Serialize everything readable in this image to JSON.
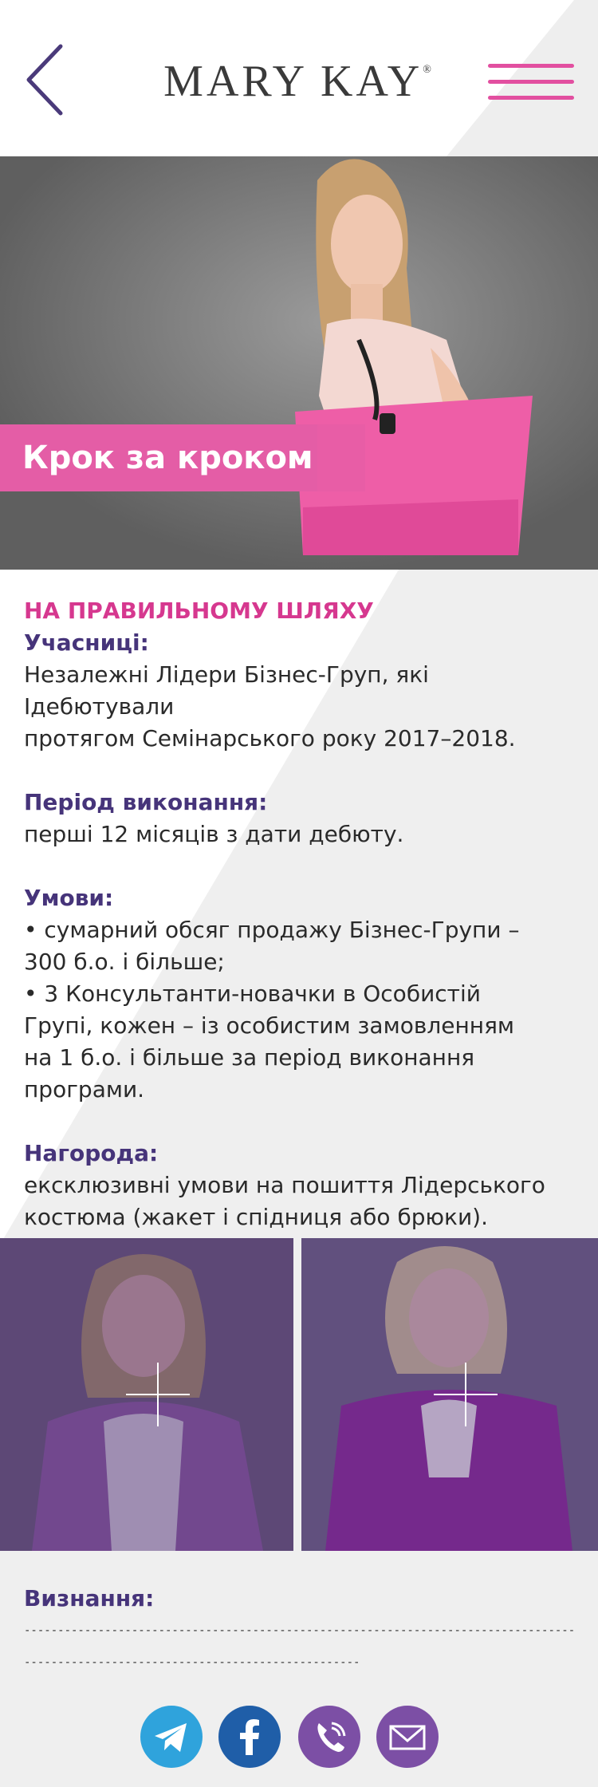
{
  "header": {
    "logo_text": "MARY KAY",
    "logo_mark": "®",
    "back_icon": "chevron-left-icon",
    "menu_icon": "hamburger-menu-icon",
    "accent_color": "#e24fa0"
  },
  "hero": {
    "title": "Крок за кроком"
  },
  "content": {
    "heading": "НА ПРАВИЛЬНОМУ ШЛЯХУ",
    "participants_label": "Учасниці:",
    "participants_lines": [
      "Незалежні Лідери Бізнес-Груп, які Ідебютували",
      "протягом Семінарського року 2017–2018."
    ],
    "period_label": "Період виконання:",
    "period_value": "перші 12 місяців з дати дебюту.",
    "conditions_label": "Умови:",
    "conditions_lines": [
      "• сумарний обсяг продажу Бізнес-Групи –",
      "300 б.о. і більше;",
      "• 3 Консультанти-новачки в Особистій",
      "Групі, кожен – із особистим замовленням",
      "на 1 б.о. і більше за період виконання",
      "програми."
    ],
    "reward_label": "Нагорода:",
    "reward_lines": [
      "ексклюзивні умови на пошиття Лідерського",
      "костюма (жакет і спідниця або брюки)."
    ]
  },
  "photos": {
    "left_icon": "plus-icon",
    "right_icon": "plus-icon"
  },
  "recognition": {
    "label": "Визнання:",
    "line1": "----------------------------------------------------------------------------------",
    "line2": "--------------------------------------------------"
  },
  "socials": [
    {
      "name": "telegram-icon",
      "color": "#2fa3dc"
    },
    {
      "name": "facebook-icon",
      "color": "#1f5ea8"
    },
    {
      "name": "viber-icon",
      "color": "#7c4fa5"
    },
    {
      "name": "email-icon",
      "color": "#7c4fa5"
    }
  ]
}
